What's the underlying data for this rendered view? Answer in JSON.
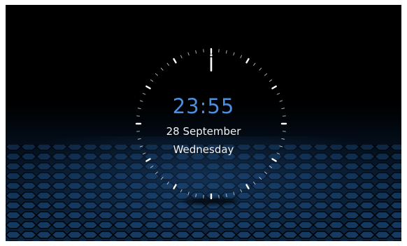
{
  "clock": {
    "time": "23:55",
    "date": "28 September",
    "weekday": "Wednesday",
    "hand_position_minutes": 0,
    "colors": {
      "time_text": "#4a8fe0",
      "ticks": "#ffffff",
      "floor_tile": "#1e4a78"
    }
  }
}
